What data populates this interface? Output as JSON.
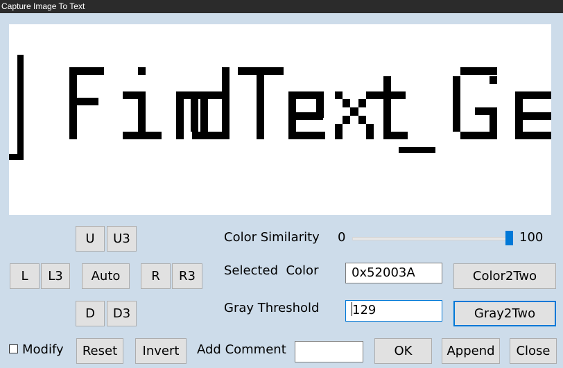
{
  "window": {
    "title": "Capture Image To Text"
  },
  "preview": {
    "text": "] FindText_Ge"
  },
  "nav": {
    "u": "U",
    "u3": "U3",
    "l": "L",
    "l3": "L3",
    "auto": "Auto",
    "r": "R",
    "r3": "R3",
    "d": "D",
    "d3": "D3"
  },
  "similarity": {
    "label": "Color Similarity",
    "min": "0",
    "max": "100",
    "value": 100
  },
  "selected_color": {
    "label": "Selected  Color",
    "value": "0x52003A",
    "button": "Color2Two"
  },
  "gray_threshold": {
    "label": "Gray Threshold",
    "value": "129",
    "button": "Gray2Two"
  },
  "bottom": {
    "modify": "Modify",
    "reset": "Reset",
    "invert": "Invert",
    "comment_label": "Add Comment",
    "comment_value": "",
    "ok": "OK",
    "append": "Append",
    "close": "Close"
  },
  "colors": {
    "titlebar": "#2b2b2b",
    "background": "#cddcea",
    "accent": "#0078d7",
    "ink": "#000000"
  }
}
